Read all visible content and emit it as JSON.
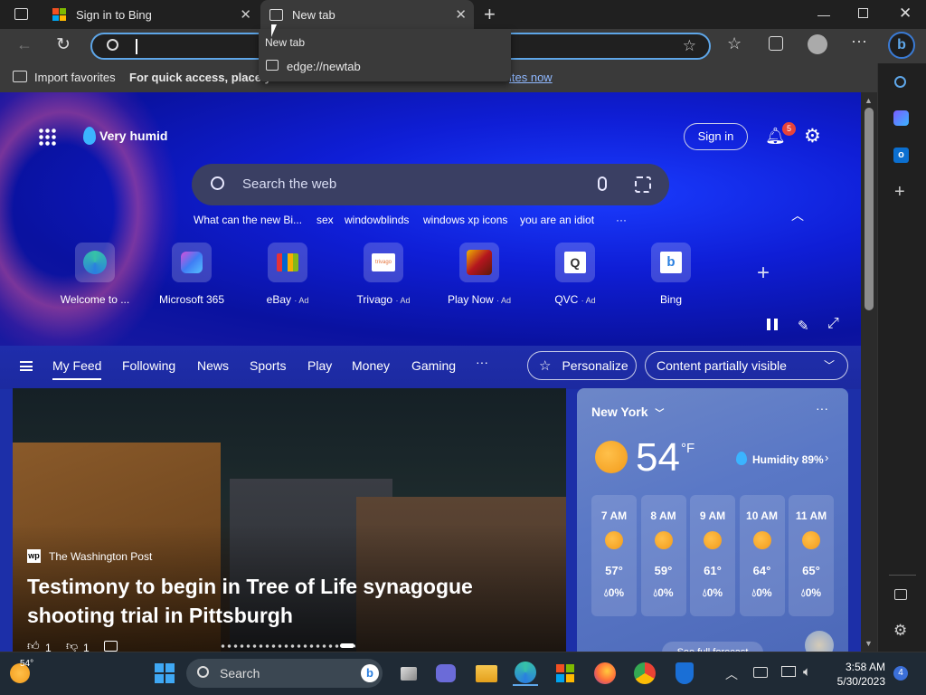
{
  "tabs": [
    {
      "title": "Sign in to Bing"
    },
    {
      "title": "New tab"
    }
  ],
  "dropdown": {
    "header": "New tab",
    "url": "edge://newtab"
  },
  "favbar": {
    "import_label": "Import favorites",
    "hint_prefix": "For quick access, place you",
    "hint_link": "ites now"
  },
  "hero": {
    "weather_label": "Very humid",
    "signin_label": "Sign in",
    "notif_count": "5",
    "search_placeholder": "Search the web",
    "suggestions": [
      "What can the new Bi...",
      "sex",
      "windowblinds",
      "windows xp icons",
      "you are an idiot",
      "···"
    ]
  },
  "tiles": [
    {
      "label": "Welcome to ...",
      "ad": ""
    },
    {
      "label": "Microsoft 365",
      "ad": ""
    },
    {
      "label": "eBay",
      "ad": "· Ad"
    },
    {
      "label": "Trivago",
      "ad": "· Ad"
    },
    {
      "label": "Play Now",
      "ad": "· Ad"
    },
    {
      "label": "QVC",
      "ad": "· Ad"
    },
    {
      "label": "Bing",
      "ad": ""
    }
  ],
  "feed": {
    "tabs": [
      "My Feed",
      "Following",
      "News",
      "Sports",
      "Play",
      "Money",
      "Gaming",
      "···"
    ],
    "personalize_label": "Personalize",
    "content_label": "Content partially visible"
  },
  "news": {
    "source": "The Washington Post",
    "headline": "Testimony to begin in Tree of Life synagogue shooting trial in Pittsburgh",
    "likes": "1",
    "dislikes": "1"
  },
  "weather": {
    "city": "New York",
    "temp": "54",
    "unit": "°F",
    "humidity": "Humidity 89%",
    "forecast_link": "See full forecast",
    "hours": [
      {
        "time": "7 AM",
        "temp": "57°",
        "precip": "0%"
      },
      {
        "time": "8 AM",
        "temp": "59°",
        "precip": "0%"
      },
      {
        "time": "9 AM",
        "temp": "61°",
        "precip": "0%"
      },
      {
        "time": "10 AM",
        "temp": "64°",
        "precip": "0%"
      },
      {
        "time": "11 AM",
        "temp": "65°",
        "precip": "0%"
      }
    ]
  },
  "taskbar": {
    "weather_temp": "54°",
    "search_label": "Search",
    "time": "3:58 AM",
    "date": "5/30/2023",
    "notif_count": "4"
  },
  "colors": {
    "accent": "#5ea6e8",
    "hero": "#1330e0",
    "sun": "#f29a1a"
  }
}
